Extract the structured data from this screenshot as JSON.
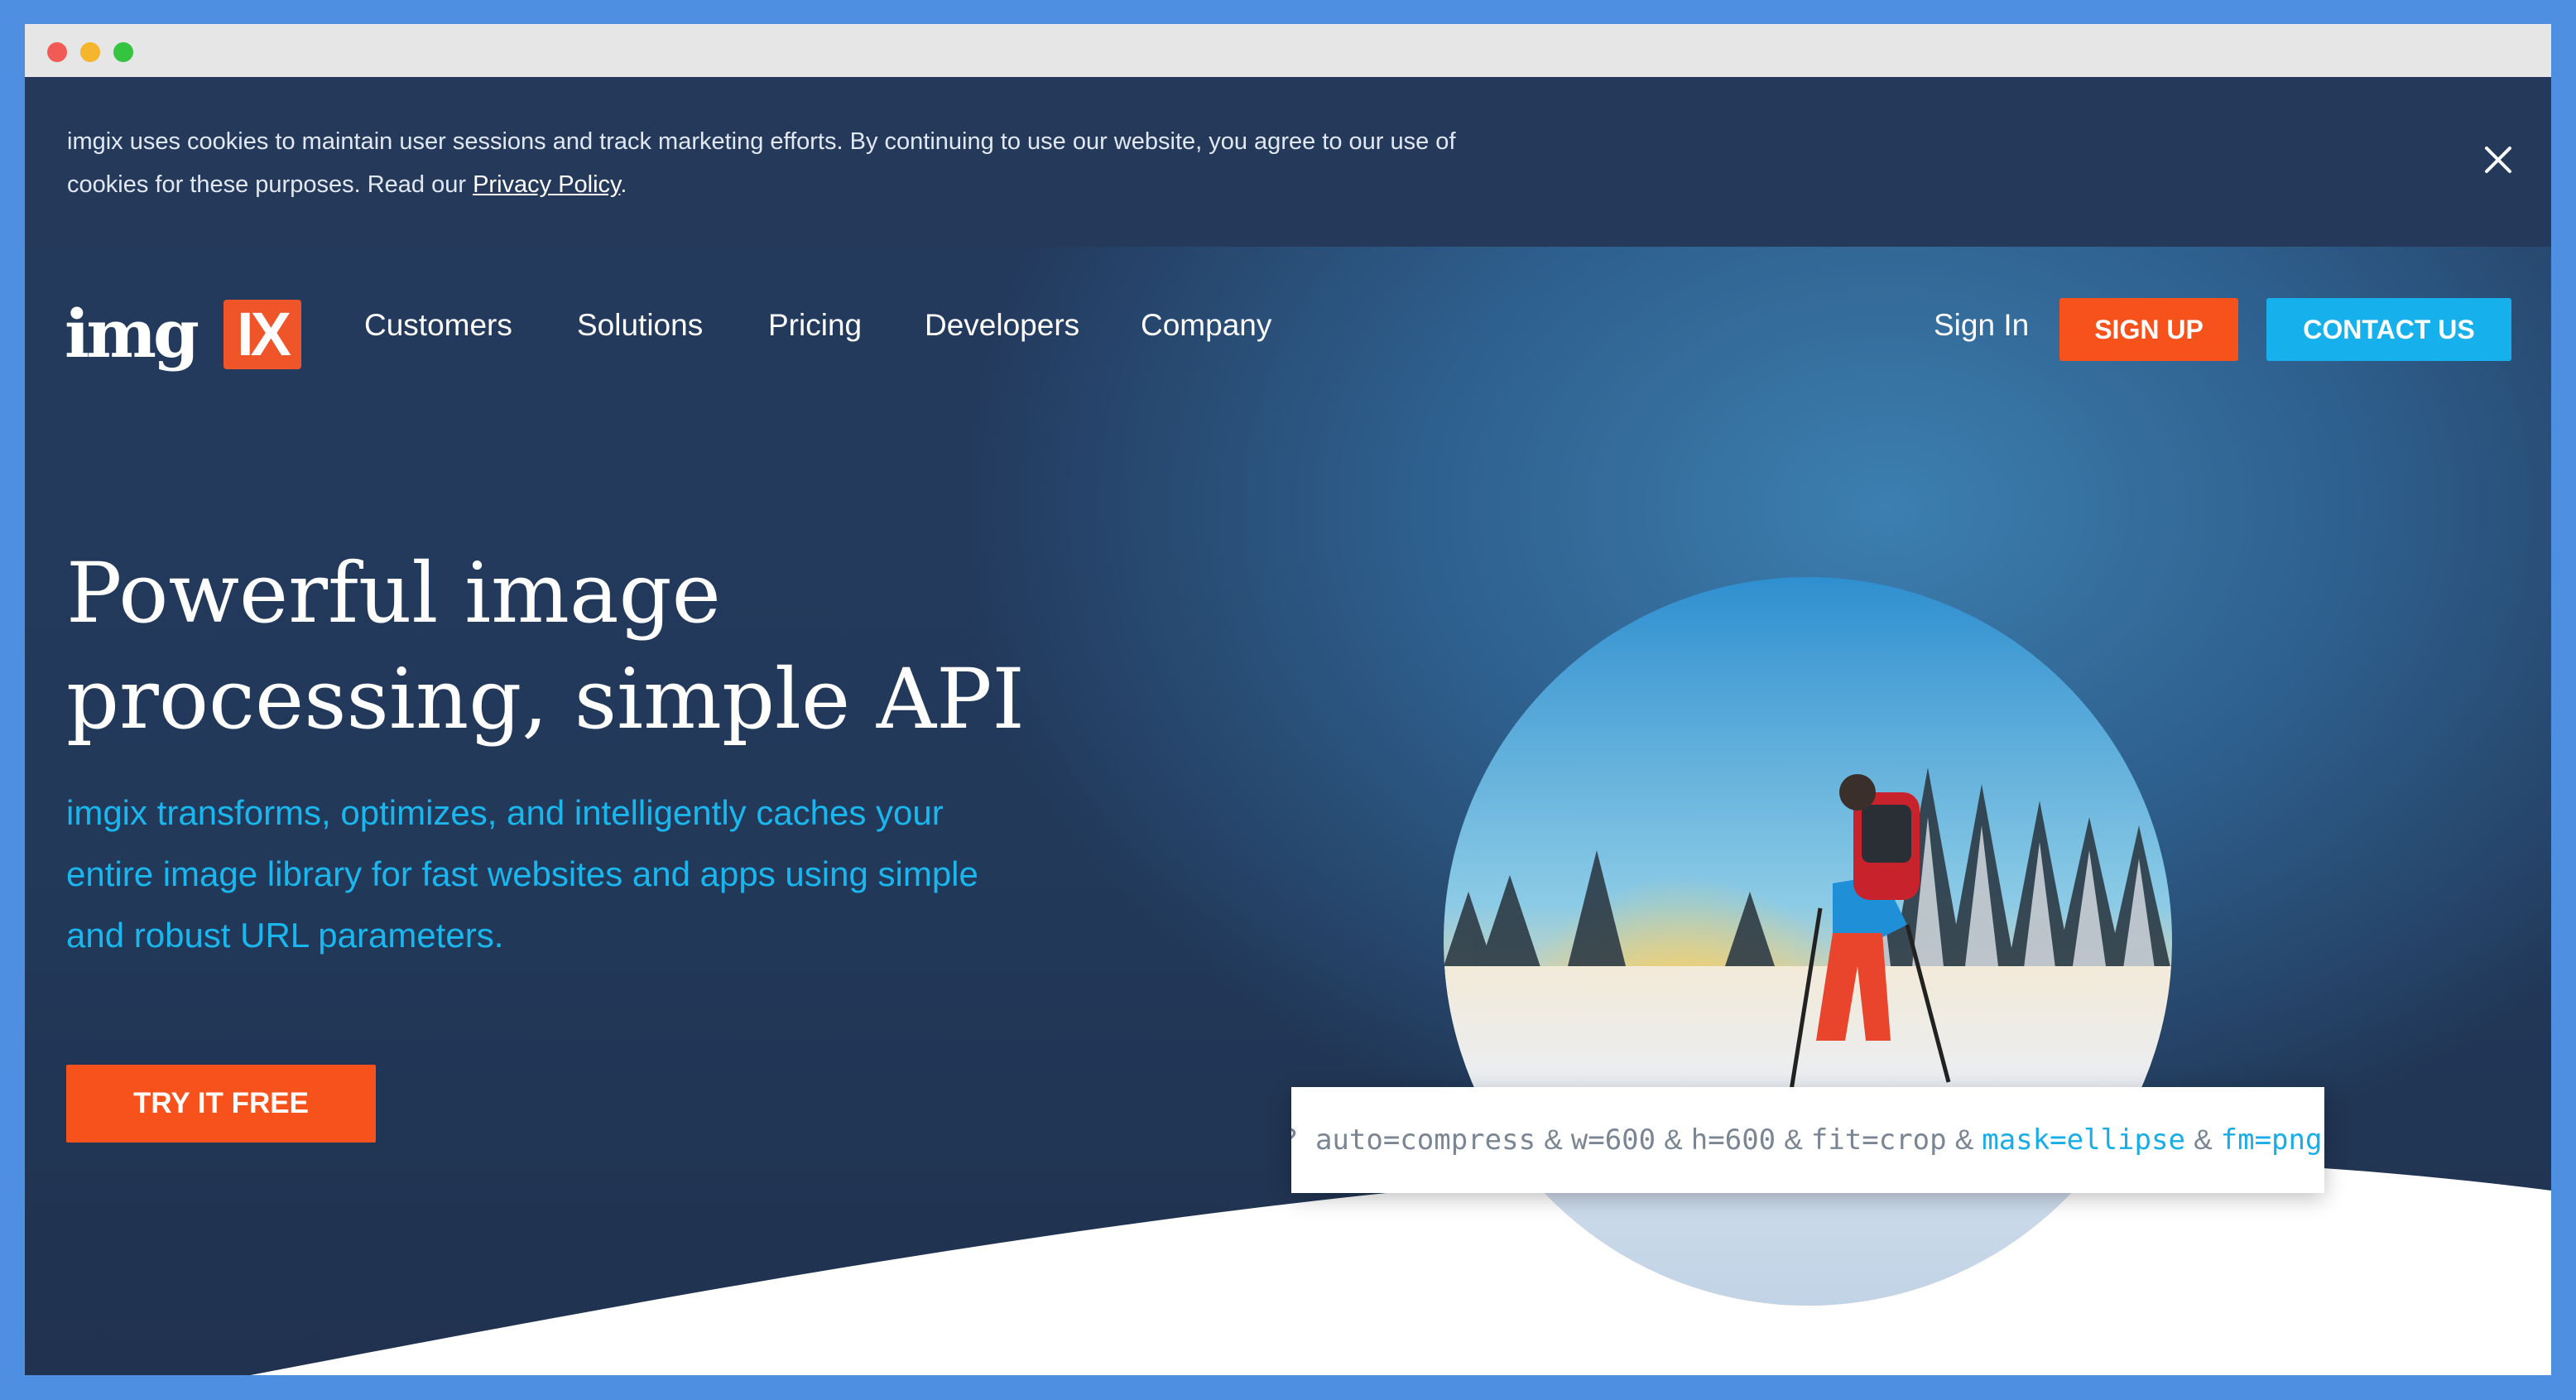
{
  "cookie_banner": {
    "text": "imgix uses cookies to maintain user sessions and track marketing efforts. By continuing to use our website, you agree to our use of cookies for these purposes. Read our ",
    "link": "Privacy Policy",
    "suffix": "."
  },
  "logo": {
    "text": "img",
    "box_text": "IX"
  },
  "nav": {
    "items": [
      "Customers",
      "Solutions",
      "Pricing",
      "Developers",
      "Company"
    ],
    "sign_in": "Sign In",
    "sign_up": "SIGN UP",
    "contact": "CONTACT US"
  },
  "hero": {
    "title_line1": "Powerful image",
    "title_line2": "processing, simple API",
    "subtitle": "imgix transforms, optimizes, and intelligently caches your entire image library for fast websites and apps using simple and robust URL parameters.",
    "cta": "TRY IT FREE"
  },
  "url_params": {
    "prefix": "?",
    "params": [
      "auto=compress",
      "w=600",
      "h=600",
      "fit=crop",
      "mask=ellipse",
      "fm=png"
    ],
    "separator": "&"
  },
  "colors": {
    "accent_orange": "#f7521c",
    "accent_blue": "#16b1ec",
    "navy": "#243a5e"
  }
}
